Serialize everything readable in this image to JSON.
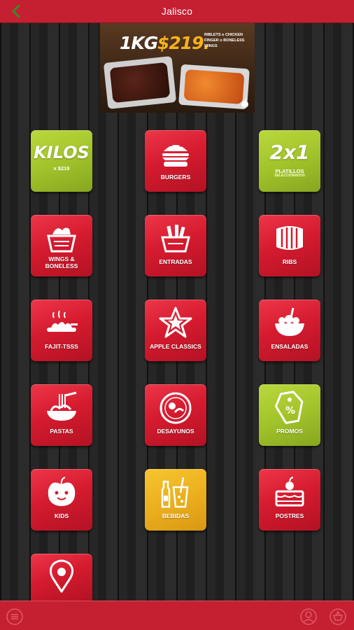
{
  "header": {
    "title": "Jalisco",
    "back_icon": "chevron-left-icon"
  },
  "banner": {
    "headline_weight": "1KG",
    "headline_price": "$219.",
    "small_text": "RIBLETS o CHICKEN FINGER o BONELESS WINGS",
    "logo_icon": "apple-icon"
  },
  "menu": [
    {
      "id": "kilos",
      "big": "KILOS",
      "sub": "x $219",
      "color": "green",
      "icon": "none"
    },
    {
      "id": "burgers",
      "label": "BURGERS",
      "color": "red",
      "icon": "burger-icon"
    },
    {
      "id": "2x1",
      "big": "2x1",
      "sub": "PLATILLOS",
      "sub2": "SELECCIONADOS",
      "color": "green",
      "icon": "none"
    },
    {
      "id": "wings",
      "label": "WINGS &\nBONELESS",
      "color": "red",
      "icon": "wings-basket-icon"
    },
    {
      "id": "entradas",
      "label": "ENTRADAS",
      "color": "red",
      "icon": "fries-basket-icon"
    },
    {
      "id": "ribs",
      "label": "RIBS",
      "color": "red",
      "icon": "ribs-icon"
    },
    {
      "id": "fajitas",
      "label": "FAJIT-TSSS",
      "color": "red",
      "icon": "fajitas-icon"
    },
    {
      "id": "apple-classics",
      "label": "APPLE CLASSICS",
      "color": "red",
      "icon": "star-icon"
    },
    {
      "id": "ensaladas",
      "label": "ENSALADAS",
      "color": "red",
      "icon": "salad-icon"
    },
    {
      "id": "pastas",
      "label": "PASTAS",
      "color": "red",
      "icon": "pasta-fork-icon"
    },
    {
      "id": "desayunos",
      "label": "DESAYUNOS",
      "color": "red",
      "icon": "breakfast-plate-icon"
    },
    {
      "id": "promos",
      "label": "PROMOS",
      "color": "green",
      "icon": "tag-icon"
    },
    {
      "id": "kids",
      "label": "KIDS",
      "color": "red",
      "icon": "apple-face-icon"
    },
    {
      "id": "bebidas",
      "label": "BEBIDAS",
      "color": "yellow",
      "icon": "drinks-icon"
    },
    {
      "id": "postres",
      "label": "POSTRES",
      "color": "red",
      "icon": "cake-icon"
    },
    {
      "id": "ubicacion",
      "label": "",
      "color": "red",
      "icon": "location-pin-icon"
    }
  ],
  "footer": {
    "left_icon": "menu-list-icon",
    "right_icons": [
      "user-icon",
      "cart-icon"
    ]
  },
  "colors": {
    "bar_red": "#c42032",
    "tile_red": "#d61b2f",
    "tile_green": "#a2c42b",
    "tile_yellow": "#ecb01e",
    "back_arrow": "#3a8a2a"
  }
}
